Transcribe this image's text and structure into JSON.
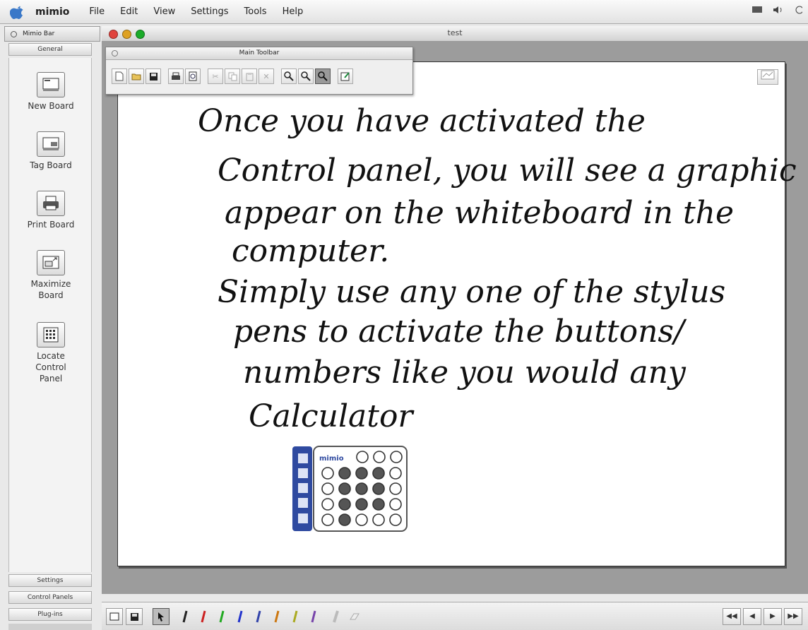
{
  "menubar": {
    "app_name": "mimio",
    "menus": [
      "File",
      "Edit",
      "View",
      "Settings",
      "Tools",
      "Help"
    ]
  },
  "mimio_bar": {
    "title": "Mimio Bar",
    "tab_general": "General",
    "tools": [
      {
        "label": "New Board",
        "icon": "new-board-icon"
      },
      {
        "label": "Tag Board",
        "icon": "tag-board-icon"
      },
      {
        "label": "Print Board",
        "icon": "print-board-icon"
      },
      {
        "label": "Maximize\nBoard",
        "icon": "maximize-board-icon"
      },
      {
        "label": "Locate\nControl\nPanel",
        "icon": "control-panel-icon"
      }
    ],
    "tab_settings": "Settings",
    "tab_control_panels": "Control Panels",
    "tab_plugins": "Plug-ins"
  },
  "window": {
    "title": "test",
    "traffic_colors": [
      "#e0443e",
      "#dea123",
      "#1aab29"
    ]
  },
  "main_toolbar": {
    "title": "Main Toolbar"
  },
  "board": {
    "lines": [
      "Once you have activated the",
      "Control panel, you will see a graphic",
      "appear on the whiteboard in the",
      "computer.",
      "Simply use any one of the stylus",
      "pens to activate the buttons/",
      "numbers like you would any",
      "Calculator"
    ],
    "calculator_brand": "mimio"
  },
  "bottom_bar": {
    "pen_colors": [
      "#222222",
      "#cc2222",
      "#22aa22",
      "#2233cc",
      "#3344aa",
      "#cc7711",
      "#aaaa22",
      "#7744aa"
    ]
  }
}
